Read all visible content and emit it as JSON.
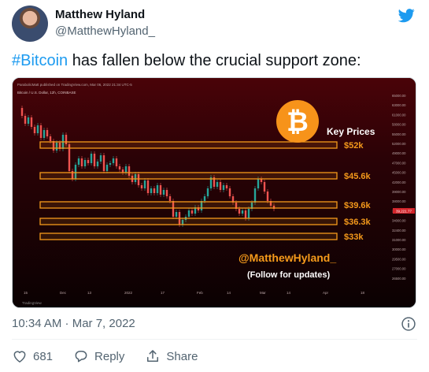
{
  "author": {
    "name": "Matthew Hyland",
    "handle": "@MatthewHyland_"
  },
  "tweet": {
    "hashtag": "#Bitcoin",
    "text": " has fallen below the crucial support zone:",
    "timestamp": "10:34 AM · Mar 7, 2022"
  },
  "actions": {
    "like_count": "681",
    "reply_label": "Reply",
    "share_label": "Share"
  },
  "colors": {
    "brand": "#1d9bf0",
    "bitcoin_orange": "#f7931a",
    "chart_band": "#f59a1b",
    "muted": "#536471"
  },
  "chart": {
    "header_line": "ParabolicMatt published on TradingView.com, Mar 06, 2022 21:34 UTC-5",
    "symbol_line": "Bitcoin / U.S. Dollar, 12h, COINBASE",
    "key_prices_label": "Key Prices",
    "levels": [
      "$52k",
      "$45.6k",
      "$39.6k",
      "$36.3k",
      "$33k"
    ],
    "watermark": "@MatthewHyland_",
    "follow_text": "(Follow for updates)",
    "price_axis": [
      "65000.00",
      "63000.00",
      "61000.00",
      "58000.00",
      "55000.00",
      "52000.00",
      "49000.00",
      "47000.00",
      "45000.00",
      "42000.00",
      "39000.00",
      "38000.00",
      "36000.00",
      "34000.00",
      "32400.00",
      "31000.00",
      "30000.00",
      "29500.00",
      "27000.00",
      "26500.00"
    ],
    "current_price": "39,221.77",
    "time_axis": [
      "15",
      "Dec",
      "13",
      "2022",
      "17",
      "Feb",
      "14",
      "Mar",
      "14",
      "Apr",
      "18"
    ],
    "footer": "TradingView"
  }
}
